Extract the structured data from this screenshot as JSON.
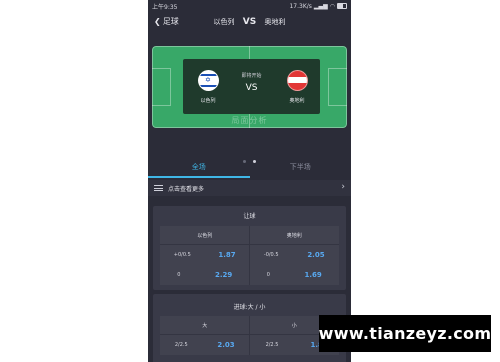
{
  "status_bar": {
    "time": "上午9:35",
    "speed": "17.3K/s",
    "battery_label": "battery"
  },
  "nav": {
    "back_label": "足球",
    "home_team": "以色列",
    "vs": "VS",
    "away_team": "奥地利"
  },
  "match": {
    "status": "即将开始",
    "vs": "VS",
    "home_team": "以色列",
    "away_team": "奥地利",
    "home_flag": "israel-flag",
    "away_flag": "austria-flag",
    "pitch_watermark": "局面分析"
  },
  "pager": {
    "pages": 2,
    "current": 2
  },
  "tabs": [
    {
      "label": "全场",
      "active": true
    },
    {
      "label": "下半场",
      "active": false
    }
  ],
  "more_bar": {
    "label": "点击查看更多",
    "icon": "menu-icon"
  },
  "handicap": {
    "title": "让球",
    "headers": [
      "以色列",
      "奥地利"
    ],
    "rows": [
      {
        "home_line": "+0/0.5",
        "home_odds": "1.87",
        "away_line": "-0/0.5",
        "away_odds": "2.05"
      },
      {
        "home_line": "0",
        "home_odds": "2.29",
        "away_line": "0",
        "away_odds": "1.69"
      }
    ]
  },
  "totals": {
    "title": "进球:大 / 小",
    "headers": [
      "大",
      "小"
    ],
    "rows": [
      {
        "home_line": "2/2.5",
        "home_odds": "2.03",
        "away_line": "2/2.5",
        "away_odds": "1.8"
      }
    ]
  },
  "banner": {
    "text": "www.tianzeyz.com"
  },
  "colors": {
    "background": "#2b2c38",
    "pitch": "#38a868",
    "accent": "#3fb6e6",
    "odds": "#58a9f1"
  }
}
